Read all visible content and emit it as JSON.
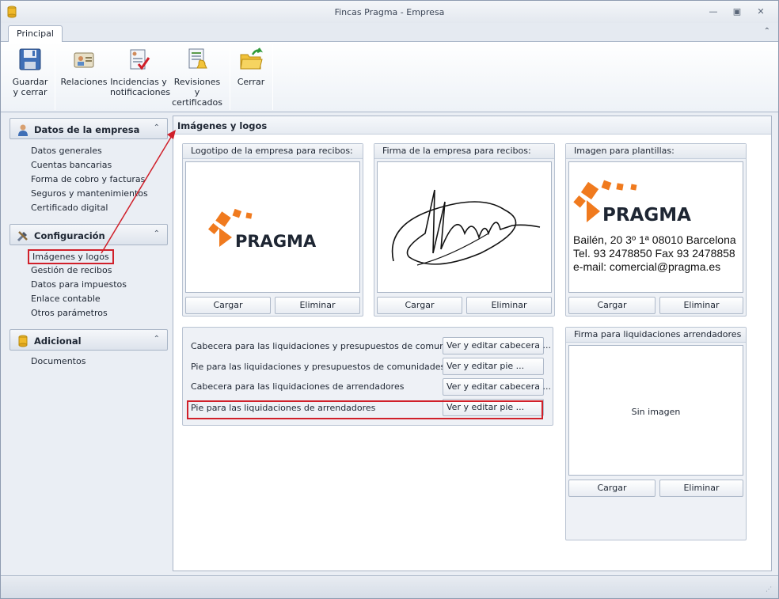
{
  "window": {
    "title": "Fincas Pragma - Empresa"
  },
  "ribbon": {
    "tab": "Principal",
    "buttons": {
      "save": "Guardar\ny cerrar",
      "relations": "Relaciones",
      "incidents": "Incidencias y\nnotificaciones",
      "revisions": "Revisiones y\ncertificados",
      "close": "Cerrar"
    }
  },
  "sidebar": {
    "groups": [
      {
        "title": "Datos de la empresa",
        "icon": "user-icon",
        "items": [
          "Datos generales",
          "Cuentas bancarias",
          "Forma de cobro y facturas",
          "Seguros y mantenimientos",
          "Certificado digital"
        ]
      },
      {
        "title": "Configuración",
        "icon": "tools-icon",
        "items": [
          "Imágenes y logos",
          "Gestión de recibos",
          "Datos para impuestos",
          "Enlace contable",
          "Otros parámetros"
        ]
      },
      {
        "title": "Adicional",
        "icon": "database-icon",
        "items": [
          "Documentos"
        ]
      }
    ]
  },
  "panel": {
    "title": "Imágenes y logos",
    "logo_box": {
      "title": "Logotipo de la empresa para recibos:",
      "load": "Cargar",
      "delete": "Eliminar"
    },
    "signature_box": {
      "title": "Firma de la empresa para recibos:",
      "load": "Cargar",
      "delete": "Eliminar"
    },
    "template_box": {
      "title": "Imagen para plantillas:",
      "lines": [
        "Bailén, 20 3º 1ª 08010 Barcelona",
        "Tel. 93 2478850 Fax 93 2478858",
        "e-mail: comercial@pragma.es"
      ],
      "load": "Cargar",
      "delete": "Eliminar"
    },
    "lease_signature_box": {
      "title": "Firma para liquidaciones arrendadores",
      "empty": "Sin imagen",
      "load": "Cargar",
      "delete": "Eliminar"
    },
    "settlements": [
      {
        "label": "Cabecera para las liquidaciones y presupuestos de comunidades",
        "button": "Ver y editar cabecera ..."
      },
      {
        "label": "Pie para las liquidaciones y presupuestos de comunidades",
        "button": "Ver y editar pie ..."
      },
      {
        "label": "Cabecera para las liquidaciones de arrendadores",
        "button": "Ver y editar cabecera ..."
      },
      {
        "label": "Pie para las liquidaciones de arrendadores",
        "button": "Ver y editar pie ..."
      }
    ]
  },
  "logo_text": "PRAGMA",
  "colors": {
    "brand_orange": "#f07a1e",
    "highlight_red": "#d0202a"
  }
}
